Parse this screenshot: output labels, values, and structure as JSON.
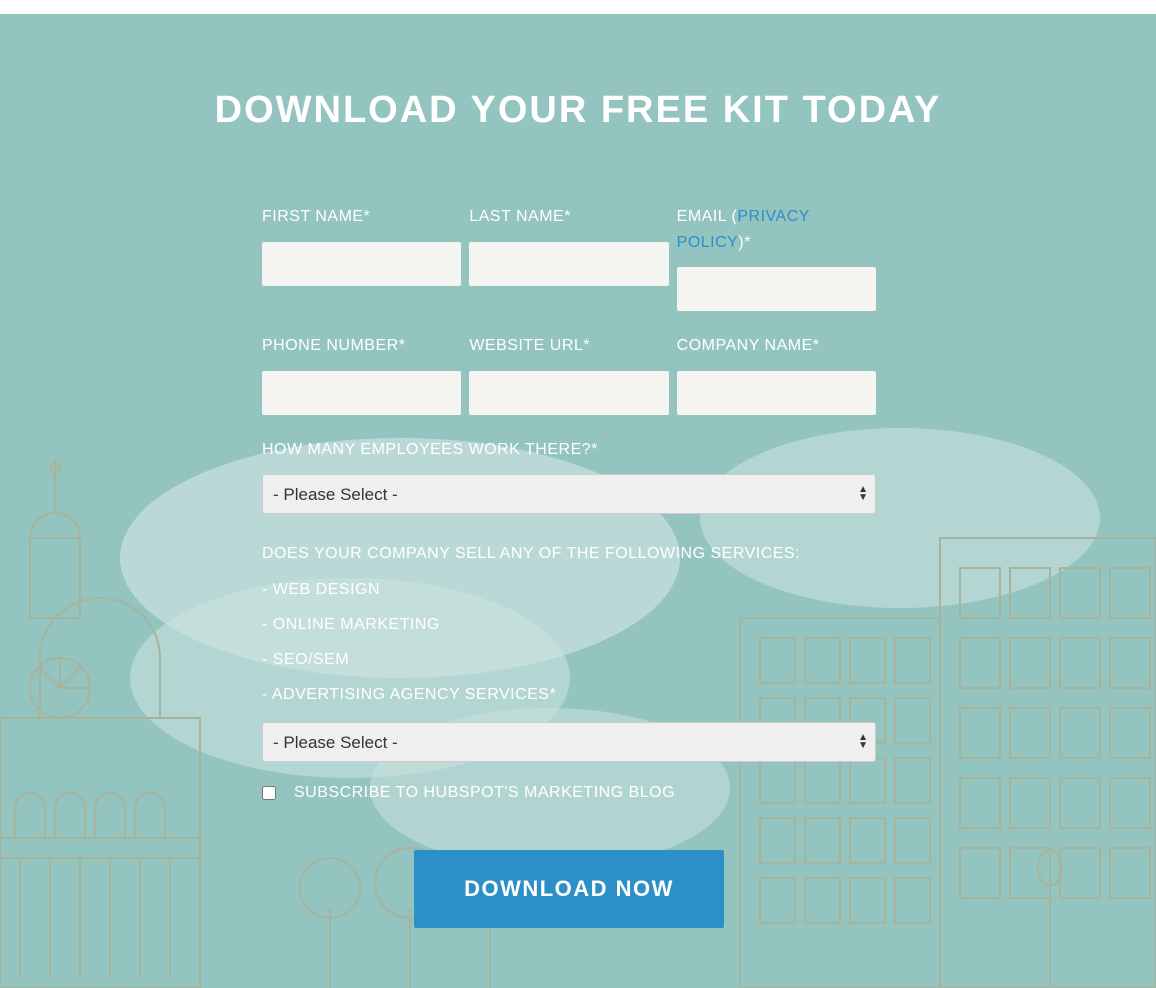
{
  "header": {
    "title": "DOWNLOAD YOUR FREE KIT TODAY"
  },
  "form": {
    "first_name_label": "FIRST NAME*",
    "last_name_label": "LAST NAME*",
    "email_label_before": "EMAIL (",
    "email_privacy_link": "PRIVACY POLICY",
    "email_label_after": ")*",
    "phone_label": "PHONE NUMBER*",
    "website_label": "WEBSITE URL*",
    "company_label": "COMPANY NAME*",
    "employees_label": "HOW MANY EMPLOYEES WORK THERE?*",
    "employees_selected": "- Please Select -",
    "services_label_line1": "DOES YOUR COMPANY SELL ANY OF THE FOLLOWING SERVICES:",
    "services_label_line2": "- WEB DESIGN",
    "services_label_line3": "- ONLINE MARKETING",
    "services_label_line4": "- SEO/SEM",
    "services_label_line5": "- ADVERTISING AGENCY SERVICES*",
    "services_selected": "- Please Select -",
    "subscribe_label": "SUBSCRIBE TO HUBSPOT'S MARKETING BLOG",
    "cta_label": "DOWNLOAD NOW"
  }
}
